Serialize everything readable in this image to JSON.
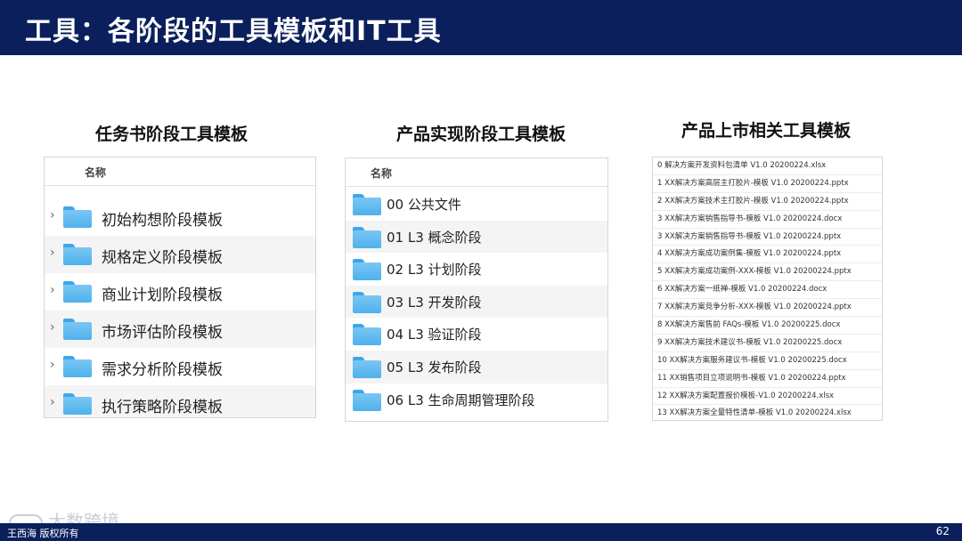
{
  "header": {
    "title": "工具：各阶段的工具模板和IT工具"
  },
  "sections": [
    {
      "title": "任务书阶段工具模板",
      "column_header": "名称",
      "items": [
        "初始构想阶段模板",
        "规格定义阶段模板",
        "商业计划阶段模板",
        "市场评估阶段模板",
        "需求分析阶段模板",
        "执行策略阶段模板"
      ]
    },
    {
      "title": "产品实现阶段工具模板",
      "column_header": "名称",
      "items": [
        "00 公共文件",
        "01 L3 概念阶段",
        "02 L3 计划阶段",
        "03 L3 开发阶段",
        "04 L3 验证阶段",
        "05 L3 发布阶段",
        "06 L3 生命周期管理阶段"
      ]
    },
    {
      "title": "产品上市相关工具模板",
      "files": [
        "0 解决方案开发资料包清单 V1.0 20200224.xlsx",
        "1 XX解决方案高层主打胶片-模板 V1.0 20200224.pptx",
        "2 XX解决方案技术主打胶片-模板 V1.0 20200224.pptx",
        "3 XX解决方案销售指导书-模板 V1.0 20200224.docx",
        "3 XX解决方案销售指导书-模板 V1.0 20200224.pptx",
        "4 XX解决方案成功案例集-模板 V1.0 20200224.pptx",
        "5 XX解决方案成功案例-XXX-模板 V1.0 20200224.pptx",
        "6 XX解决方案一纸禅-模板 V1.0 20200224.docx",
        "7 XX解决方案竞争分析-XXX-模板 V1.0 20200224.pptx",
        "8 XX解决方案售前 FAQs-模板 V1.0 20200225.docx",
        "9 XX解决方案技术建议书-模板 V1.0 20200225.docx",
        "10 XX解决方案服务建议书-模板 V1.0 20200225.docx",
        "11 XX销售项目立项说明书-模板 V1.0 20200224.pptx",
        "12 XX解决方案配置报价模板-V1.0 20200224.xlsx",
        "13 XX解决方案全量特性清单-模板 V1.0 20200224.xlsx"
      ]
    }
  ],
  "footer": {
    "credit": "王西海 版权所有",
    "page": "62",
    "watermark": "大数跨境"
  }
}
